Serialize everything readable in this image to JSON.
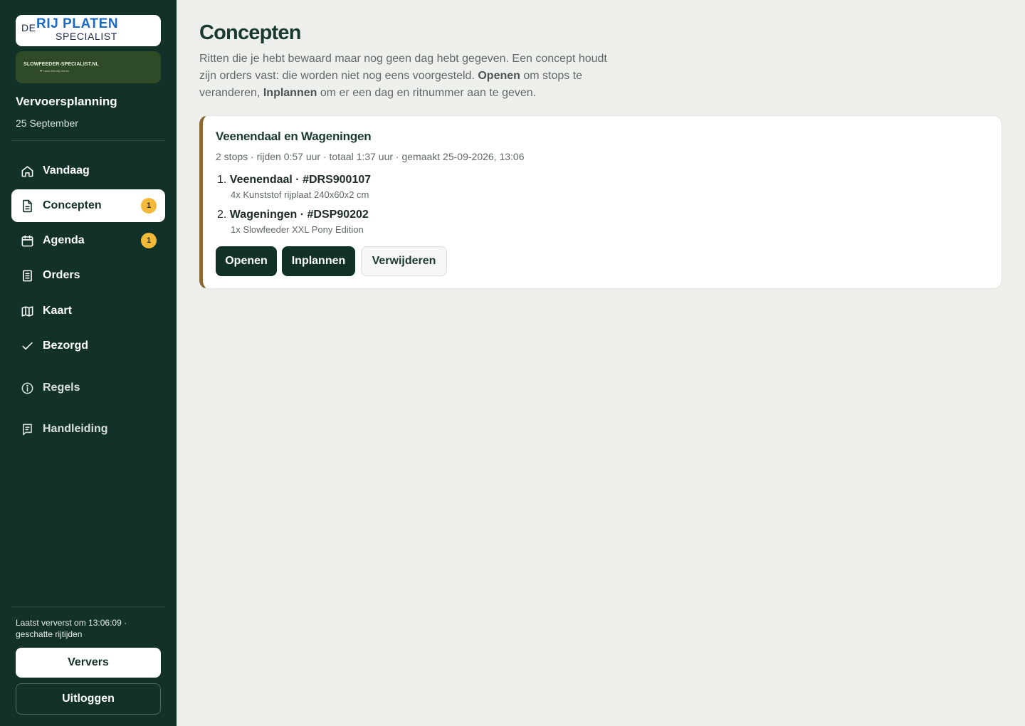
{
  "brand": {
    "logo": {
      "de": "DE",
      "rij": "RIJ",
      "platen": "PLATEN",
      "specialist": "SPECIALIST"
    },
    "banner_text": "SLOWFEEDER-SPECIALIST.NL",
    "banner_sub": "❤ horse-friendly feeder"
  },
  "sidebar": {
    "app_title": "Vervoersplanning",
    "date": "25 September",
    "nav": [
      {
        "label": "Vandaag",
        "icon": "home-icon",
        "active": false,
        "badge": ""
      },
      {
        "label": "Concepten",
        "icon": "document-icon",
        "active": true,
        "badge": "1"
      },
      {
        "label": "Agenda",
        "icon": "calendar-icon",
        "active": false,
        "badge": "1"
      },
      {
        "label": "Orders",
        "icon": "list-icon",
        "active": false,
        "badge": ""
      },
      {
        "label": "Kaart",
        "icon": "map-icon",
        "active": false,
        "badge": ""
      },
      {
        "label": "Bezorgd",
        "icon": "check-icon",
        "active": false,
        "badge": ""
      },
      {
        "label": "Regels",
        "icon": "info-icon",
        "active": false,
        "badge": ""
      },
      {
        "label": "Handleiding",
        "icon": "book-icon",
        "active": false,
        "badge": ""
      }
    ],
    "refresh_note": "Laatst ververst om 13:06:09 · geschatte rijtijden",
    "refresh_button": "Ververs",
    "logout_button": "Uitloggen"
  },
  "main": {
    "title": "Concepten",
    "intro": {
      "part1": "Ritten die je hebt bewaard maar nog geen dag hebt gegeven. Een concept houdt zijn orders vast: die worden niet nog eens voorgesteld. ",
      "bold1": "Openen",
      "part2": " om stops te veranderen, ",
      "bold2": "Inplannen",
      "part3": " om er een dag en ritnummer aan te geven."
    },
    "concepts": [
      {
        "title": "Veenendaal en Wageningen",
        "meta": "2 stops · rijden 0:57 uur · totaal 1:37 uur · gemaakt 25-09-2026, 13:06",
        "stops": [
          {
            "number": "1.",
            "name": "Veenendaal · #DRS900107",
            "detail": "4x Kunststof rijplaat 240x60x2 cm"
          },
          {
            "number": "2.",
            "name": "Wageningen · #DSP90202",
            "detail": "1x Slowfeeder XXL Pony Edition"
          }
        ],
        "actions": {
          "open": "Openen",
          "schedule": "Inplannen",
          "delete": "Verwijderen"
        }
      }
    ]
  },
  "colors": {
    "sidebar_bg": "#123129",
    "page_bg": "#eef0eb",
    "badge": "#f2b93b",
    "card_accent": "#8a6a2f",
    "logo_blue": "#1b6bc4"
  }
}
